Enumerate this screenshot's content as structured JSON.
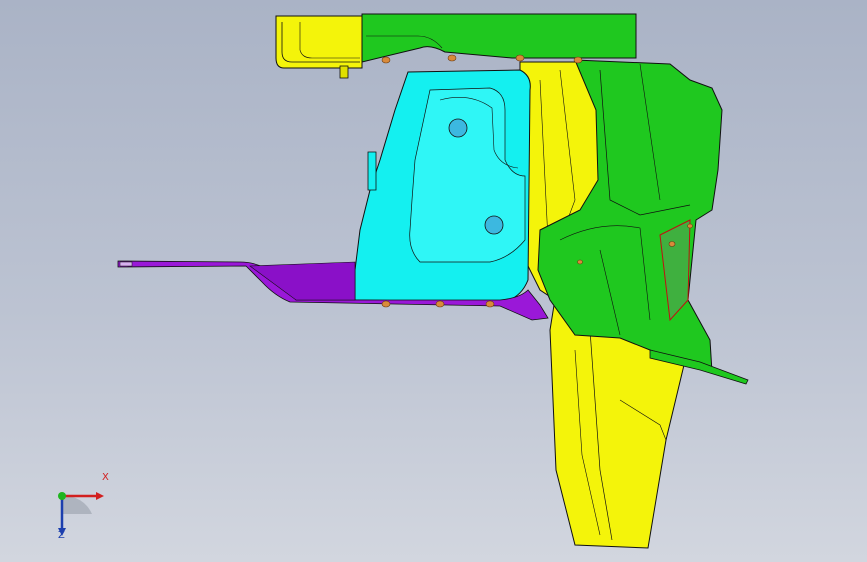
{
  "viewport": {
    "background_top": "#aab3c6",
    "background_bottom": "#d2d6df"
  },
  "model": {
    "colors": {
      "yellow": "#f4f40a",
      "green": "#1fc81f",
      "cyan": "#14f0f0",
      "purple": "#9a18d8",
      "edge": "#101010",
      "fastener": "#d98a3a",
      "hole": "#3cb8e0"
    }
  },
  "triad": {
    "x_label": "X",
    "z_label": "Z",
    "x_color": "#d21f1f",
    "y_color": "#1fb51f",
    "z_color": "#1c3fae"
  }
}
